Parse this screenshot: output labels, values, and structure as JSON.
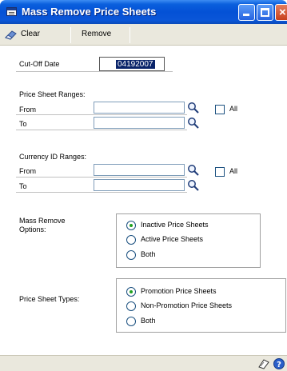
{
  "window": {
    "title": "Mass Remove Price Sheets",
    "icon": "window-form-icon"
  },
  "toolbar": {
    "clear_label": "Clear",
    "remove_label": "Remove",
    "clear_icon": "eraser-icon"
  },
  "cutoff": {
    "label": "Cut-Off Date",
    "value": "04192007"
  },
  "price_sheet_ranges": {
    "heading": "Price Sheet Ranges:",
    "from_label": "From",
    "to_label": "To",
    "from_value": "",
    "to_value": "",
    "all_label": "All",
    "all_checked": false
  },
  "currency_ranges": {
    "heading": "Currency ID Ranges:",
    "from_label": "From",
    "to_label": "To",
    "from_value": "",
    "to_value": "",
    "all_label": "All",
    "all_checked": false
  },
  "mass_remove_options": {
    "label_line1": "Mass Remove",
    "label_line2": "Options:",
    "options": [
      {
        "label": "Inactive Price Sheets",
        "checked": true
      },
      {
        "label": "Active Price Sheets",
        "checked": false
      },
      {
        "label": "Both",
        "checked": false
      }
    ]
  },
  "price_sheet_types": {
    "label": "Price Sheet Types:",
    "options": [
      {
        "label": "Promotion Price Sheets",
        "checked": true
      },
      {
        "label": "Non-Promotion Price Sheets",
        "checked": false
      },
      {
        "label": "Both",
        "checked": false
      }
    ]
  },
  "colors": {
    "titlebar": "#0451d6",
    "toolbar_bg": "#eae8dd",
    "selection": "#0a246a",
    "radio_dot": "#21a121"
  }
}
